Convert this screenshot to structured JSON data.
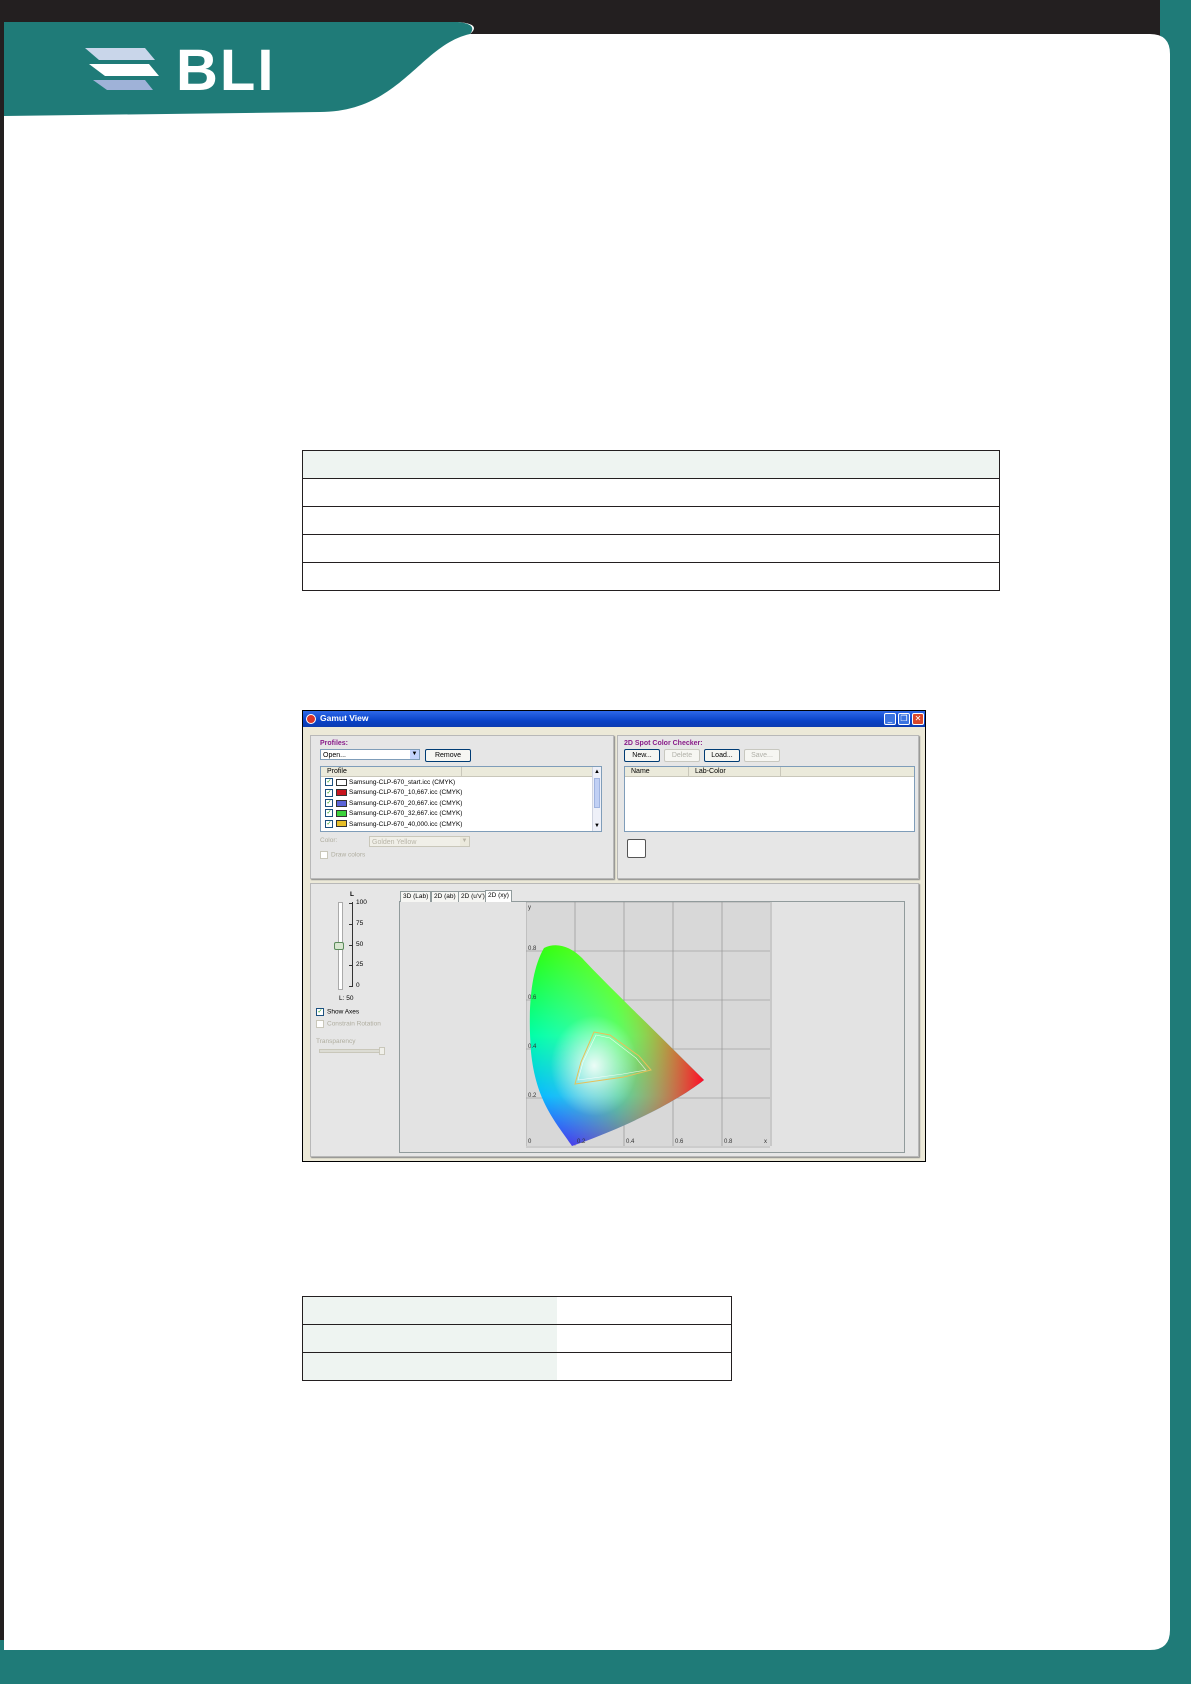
{
  "brand": {
    "logo_text": "BLI"
  },
  "table1": {
    "rows": 5
  },
  "table2": {
    "rows": 3
  },
  "window": {
    "title": "Gamut View",
    "profiles": {
      "group_label": "Profiles:",
      "open_combo": "Open...",
      "remove_button": "Remove",
      "column_header": "Profile",
      "items": [
        {
          "label": "Samsung-CLP-670_start.icc (CMYK)",
          "swatch": "#ffffff"
        },
        {
          "label": "Samsung-CLP-670_10,667.icc (CMYK)",
          "swatch": "#c8141e"
        },
        {
          "label": "Samsung-CLP-670_20,667.icc (CMYK)",
          "swatch": "#5a64d8"
        },
        {
          "label": "Samsung-CLP-670_32,667.icc (CMYK)",
          "swatch": "#3cd23c"
        },
        {
          "label": "Samsung-CLP-670_40,000.icc (CMYK)",
          "swatch": "#e6be28"
        }
      ],
      "color_label": "Color:",
      "color_value": "Golden Yellow",
      "draw_colors_label": "Draw colors"
    },
    "spot_checker": {
      "group_label": "2D Spot Color Checker:",
      "new_button": "New...",
      "delete_button": "Delete",
      "load_button": "Load...",
      "save_button": "Save...",
      "col_name": "Name",
      "col_lab": "Lab-Color"
    },
    "controls": {
      "slider_title": "L",
      "ticks": [
        "100",
        "75",
        "50",
        "25",
        "0"
      ],
      "l_value": "L: 50",
      "show_axes": "Show Axes",
      "constrain_rotation": "Constrain Rotation",
      "transparency": "Transparency"
    },
    "tabs": [
      "3D (Lab)",
      "2D (ab)",
      "2D (u'v')",
      "2D (xy)"
    ],
    "plot": {
      "y_axis_label": "y",
      "x_axis_label": "x",
      "y_ticks": [
        "0.8",
        "0.6",
        "0.4",
        "0.2"
      ],
      "x_ticks": [
        "0",
        "0.2",
        "0.4",
        "0.6",
        "0.8"
      ]
    }
  }
}
